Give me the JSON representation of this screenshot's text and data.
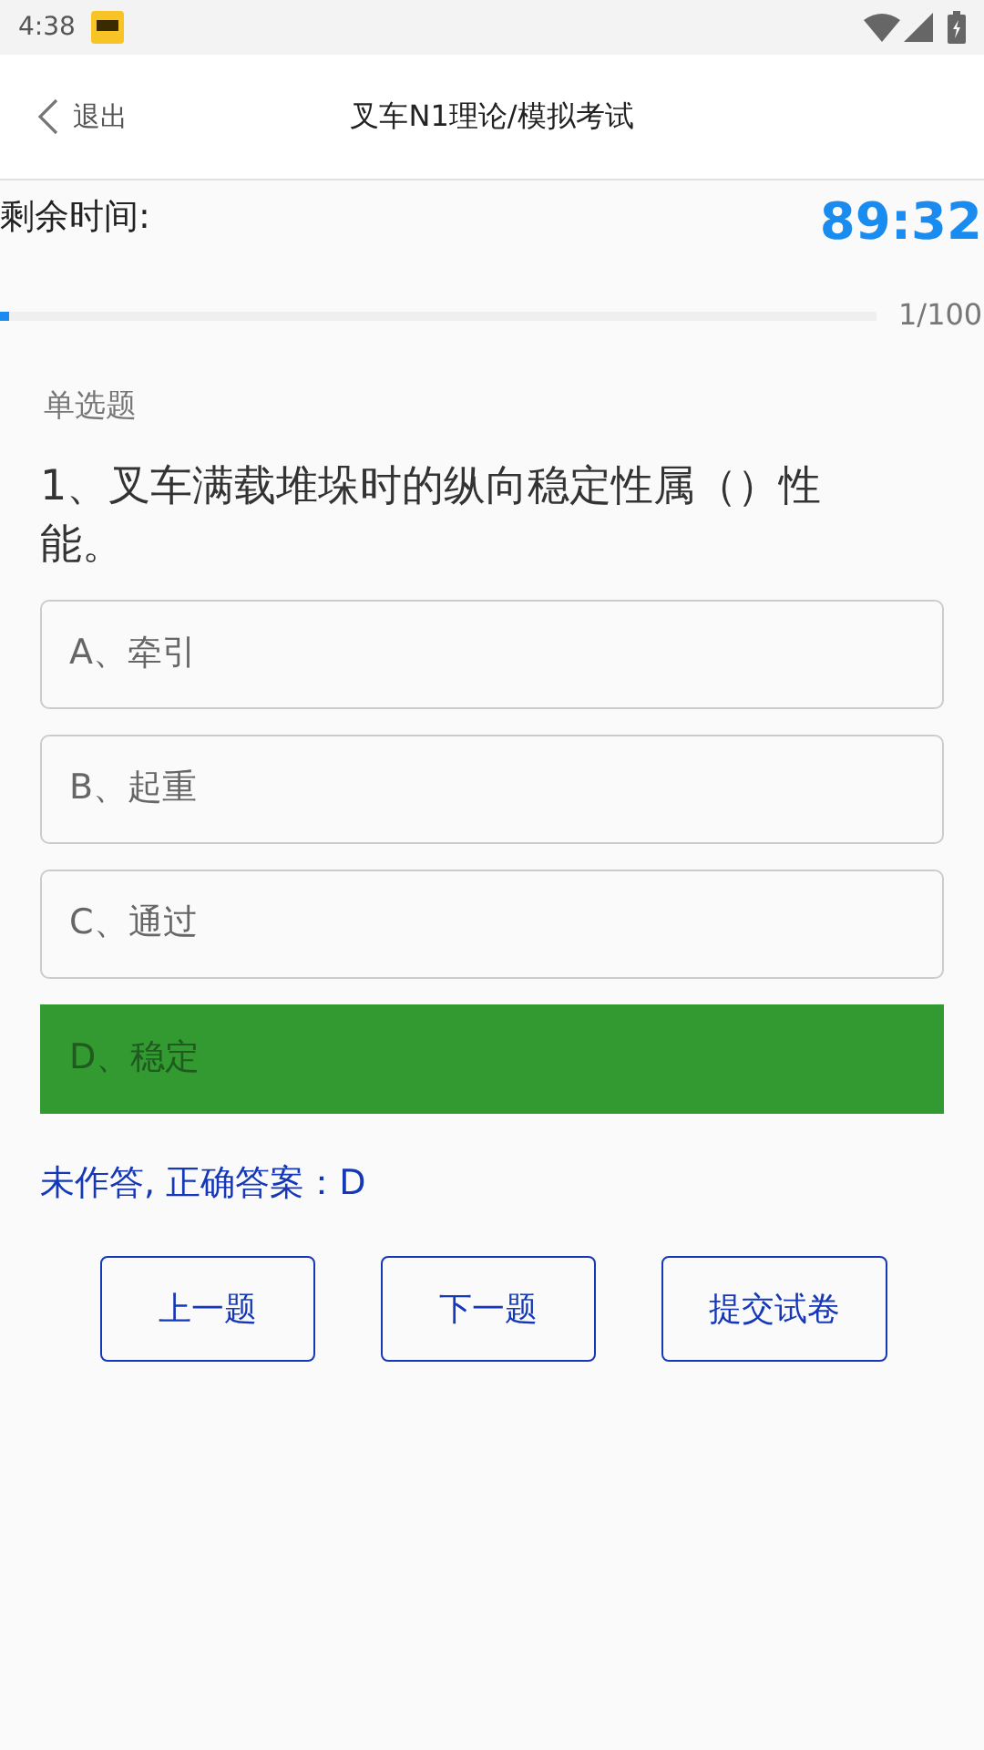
{
  "status_bar": {
    "time": "4:38"
  },
  "header": {
    "back_label": "退出",
    "title": "叉车N1理论/模拟考试"
  },
  "timer": {
    "label": "剩余时间:",
    "value": "89:32"
  },
  "progress": {
    "level": 0.01,
    "reading": "1/100"
  },
  "question": {
    "type_label": "单选题",
    "text": "1、叉车满载堆垛时的纵向稳定性属（）性能。",
    "options": [
      {
        "label": "A、牵引",
        "correct": false
      },
      {
        "label": "B、起重",
        "correct": false
      },
      {
        "label": "C、通过",
        "correct": false
      },
      {
        "label": "D、稳定",
        "correct": true
      }
    ],
    "answer_note": "未作答, 正确答案：D"
  },
  "buttons": [
    "上一题",
    "下一题",
    "提交试卷"
  ]
}
